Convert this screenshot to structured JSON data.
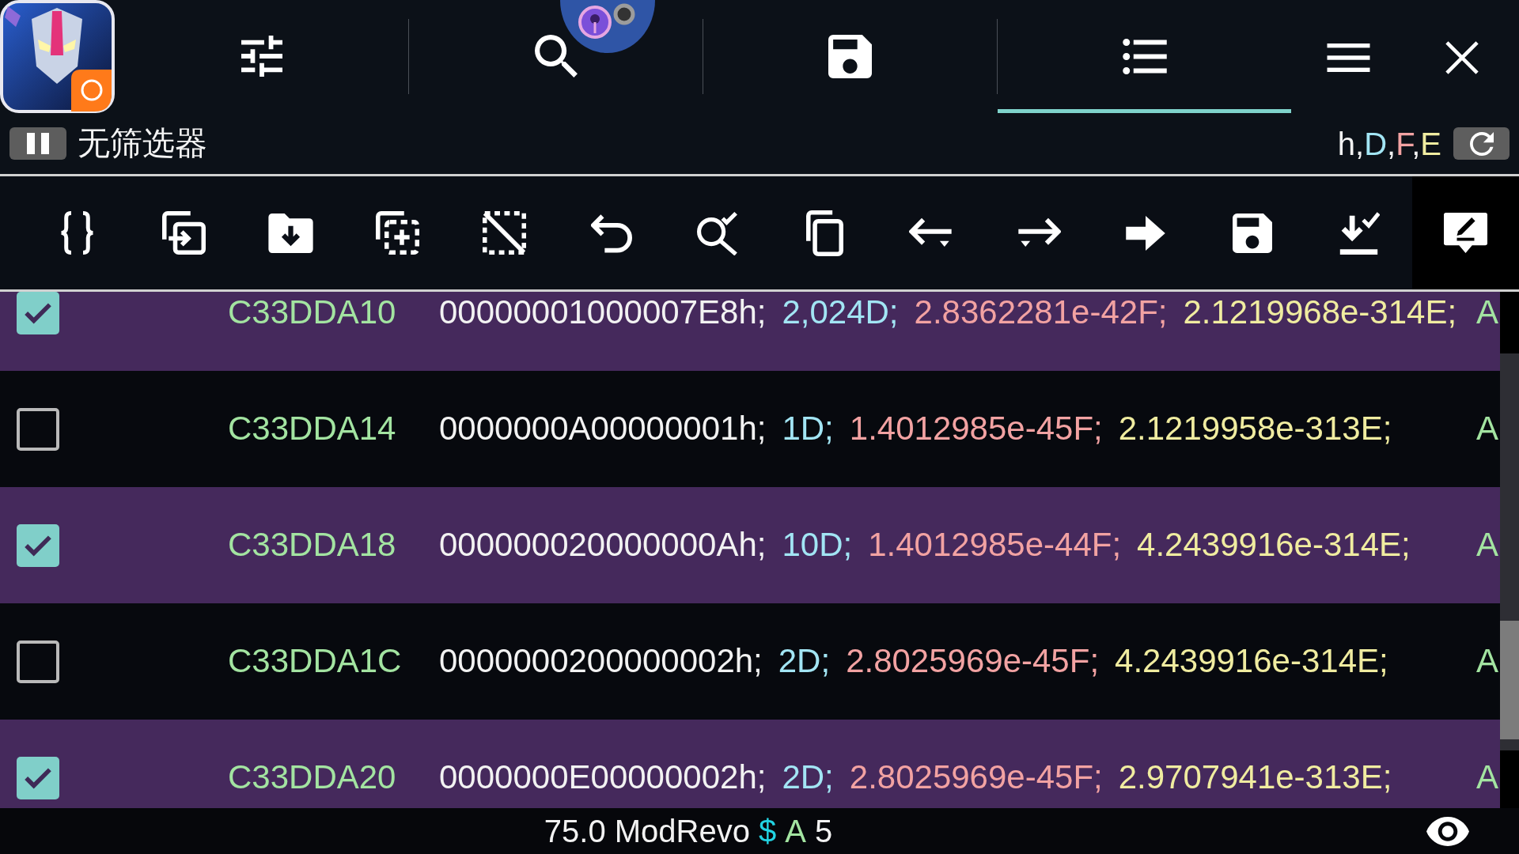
{
  "tabs": [
    {
      "kind": "filter",
      "selected": false
    },
    {
      "kind": "search",
      "selected": false
    },
    {
      "kind": "save",
      "selected": false
    },
    {
      "kind": "list",
      "selected": true
    }
  ],
  "filter_bar": {
    "label": "无筛选器",
    "type_flags": [
      {
        "text": "h",
        "color": "#f2f2f2"
      },
      {
        "text": ",",
        "color": "#f2f2f2"
      },
      {
        "text": "D",
        "color": "#a2e5f4"
      },
      {
        "text": ",",
        "color": "#f2f2f2"
      },
      {
        "text": "F",
        "color": "#f2a2a2"
      },
      {
        "text": ",",
        "color": "#f2f2f2"
      },
      {
        "text": "E",
        "color": "#f0eca0"
      }
    ]
  },
  "rows": [
    {
      "checked": true,
      "address": "C33DDA10",
      "hex": "00000001000007E8h;",
      "dword": "2,024D;",
      "float": "2.8362281e-42F;",
      "double": "2.1219968e-314E;",
      "type": "A"
    },
    {
      "checked": false,
      "address": "C33DDA14",
      "hex": "0000000A00000001h;",
      "dword": "1D;",
      "float": "1.4012985e-45F;",
      "double": "2.1219958e-313E;",
      "type": "A"
    },
    {
      "checked": true,
      "address": "C33DDA18",
      "hex": "000000020000000Ah;",
      "dword": "10D;",
      "float": "1.4012985e-44F;",
      "double": "4.2439916e-314E;",
      "type": "A"
    },
    {
      "checked": false,
      "address": "C33DDA1C",
      "hex": "0000000200000002h;",
      "dword": "2D;",
      "float": "2.8025969e-45F;",
      "double": "4.2439916e-314E;",
      "type": "A"
    },
    {
      "checked": true,
      "address": "C33DDA20",
      "hex": "0000000E00000002h;",
      "dword": "2D;",
      "float": "2.8025969e-45F;",
      "double": "2.9707941e-313E;",
      "type": "A"
    }
  ],
  "status_bar": {
    "version": "75.0 ModRevo",
    "symbol": "$",
    "type": "A",
    "count": "5"
  }
}
